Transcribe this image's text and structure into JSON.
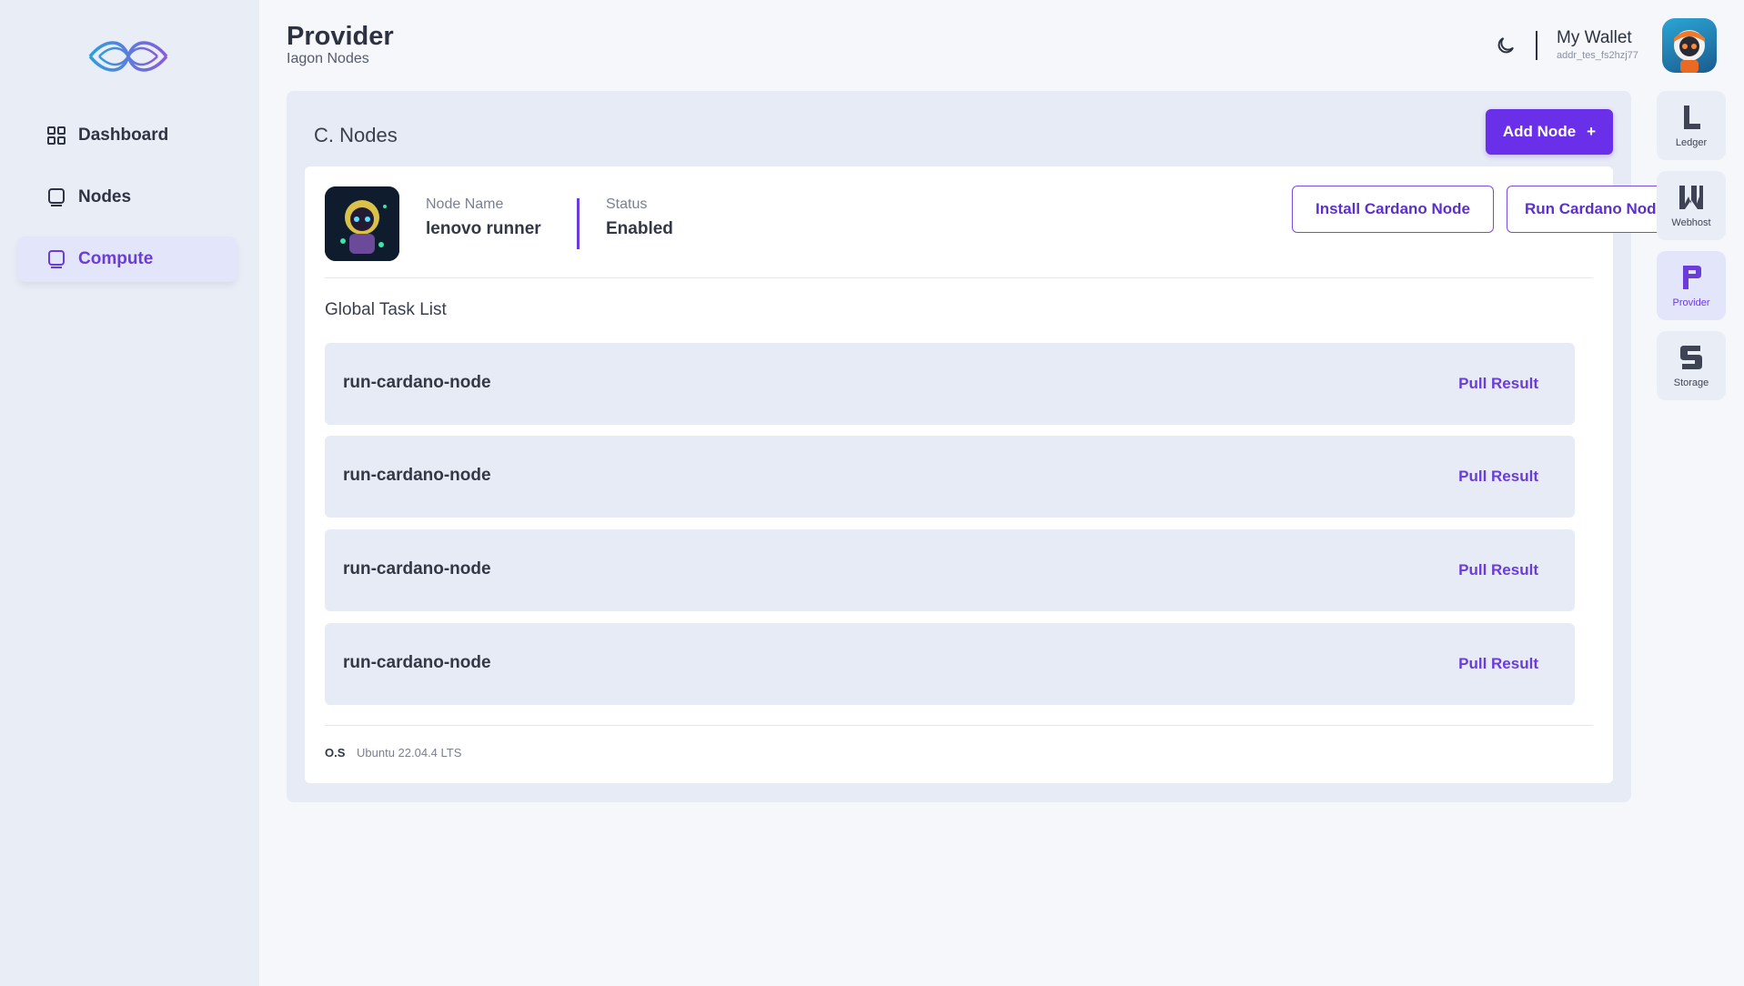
{
  "sidebar": {
    "logo_icon": "iagon-logo-icon",
    "items": [
      {
        "label": "Dashboard",
        "icon": "grid-icon",
        "active": false
      },
      {
        "label": "Nodes",
        "icon": "monitor-icon",
        "active": false
      },
      {
        "label": "Compute",
        "icon": "monitor-icon",
        "active": true
      }
    ]
  },
  "header": {
    "title": "Provider",
    "subtitle": "Iagon Nodes",
    "theme_icon": "moon-icon",
    "wallet_title": "My Wallet",
    "wallet_address": "addr_tes_fs2hzj77"
  },
  "main": {
    "panel_title": "C. Nodes",
    "add_node_label": "Add Node",
    "add_node_icon": "+",
    "node": {
      "name_label": "Node Name",
      "name_value": "lenovo runner",
      "status_label": "Status",
      "status_value": "Enabled"
    },
    "install_button": "Install Cardano Node",
    "run_button": "Run Cardano Node",
    "task_list_title": "Global Task List",
    "tasks": [
      {
        "name": "run-cardano-node",
        "action": "Pull Result"
      },
      {
        "name": "run-cardano-node",
        "action": "Pull Result"
      },
      {
        "name": "run-cardano-node",
        "action": "Pull Result"
      },
      {
        "name": "run-cardano-node",
        "action": "Pull Result"
      }
    ],
    "os_label": "O.S",
    "os_value": "Ubuntu 22.04.4 LTS"
  },
  "right_rail": {
    "items": [
      {
        "label": "Ledger",
        "icon": "ledger-icon",
        "active": false
      },
      {
        "label": "Webhost",
        "icon": "webhost-icon",
        "active": false
      },
      {
        "label": "Provider",
        "icon": "provider-icon",
        "active": true
      },
      {
        "label": "Storage",
        "icon": "storage-icon",
        "active": false
      }
    ]
  },
  "colors": {
    "accent": "#6a2fe8",
    "sidebar_bg": "#e9edf6",
    "page_bg": "#f5f7fb",
    "panel_bg": "#e7ebf5"
  }
}
